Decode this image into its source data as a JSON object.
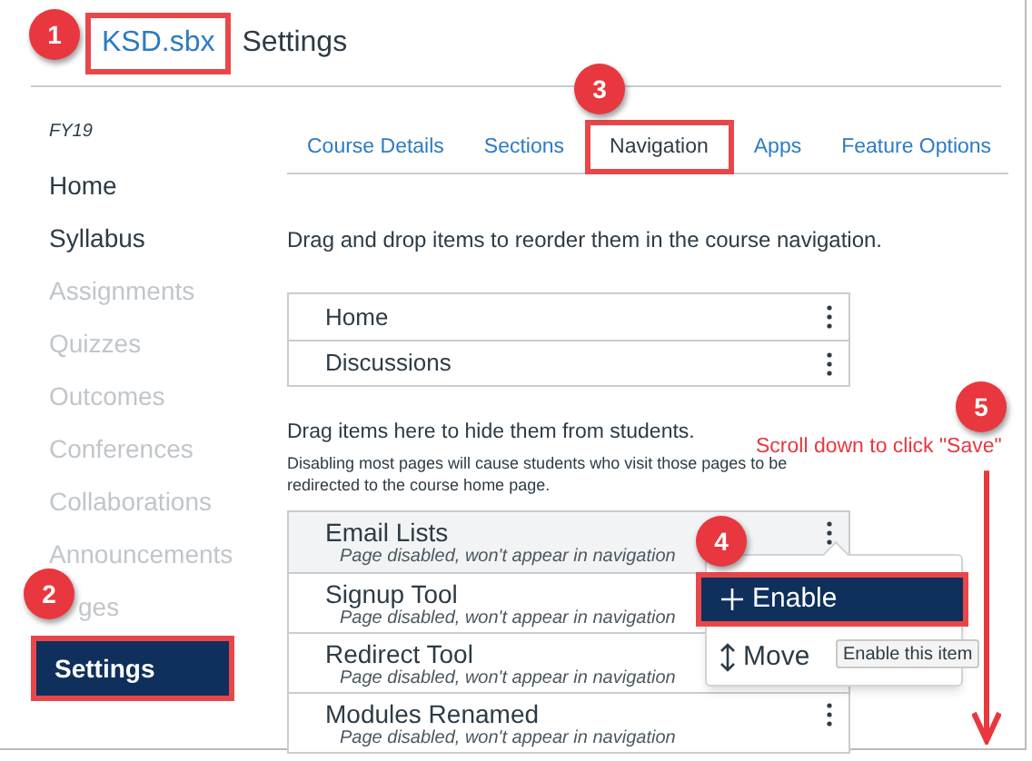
{
  "header": {
    "course_link": {
      "text": "KSD.sbx",
      "marked": true
    },
    "title": "Settings"
  },
  "sidebar": {
    "term": "FY19",
    "items": [
      {
        "label": "Home",
        "disabled": false,
        "selected": false,
        "marked": false
      },
      {
        "label": "Syllabus",
        "disabled": false,
        "selected": false,
        "marked": false
      },
      {
        "label": "Assignments",
        "disabled": true,
        "selected": false,
        "marked": false
      },
      {
        "label": "Quizzes",
        "disabled": true,
        "selected": false,
        "marked": false
      },
      {
        "label": "Outcomes",
        "disabled": true,
        "selected": false,
        "marked": false
      },
      {
        "label": "Conferences",
        "disabled": true,
        "selected": false,
        "marked": false
      },
      {
        "label": "Collaborations",
        "disabled": true,
        "selected": false,
        "marked": false
      },
      {
        "label": "Announcements",
        "disabled": true,
        "selected": false,
        "marked": false
      },
      {
        "label": "ges",
        "disabled": true,
        "selected": false,
        "marked": false
      },
      {
        "label": "Settings",
        "disabled": false,
        "selected": true,
        "marked": true
      }
    ]
  },
  "tabs": [
    {
      "label": "Course Details",
      "selected": false,
      "marked": false
    },
    {
      "label": "Sections",
      "selected": false,
      "marked": false
    },
    {
      "label": "Navigation",
      "selected": true,
      "marked": true
    },
    {
      "label": "Apps",
      "selected": false,
      "marked": false
    },
    {
      "label": "Feature Options",
      "selected": false,
      "marked": false
    }
  ],
  "navigation": {
    "instructions": "Drag and drop items to reorder them in the course navigation.",
    "enabled_items": [
      {
        "label": "Home"
      },
      {
        "label": "Discussions"
      }
    ],
    "hidden_heading": "Drag items here to hide them from students.",
    "hidden_note": "Disabling most pages will cause students who visit those pages to be redirected to the course home page.",
    "hidden_items": [
      {
        "label": "Email Lists",
        "status": "Page disabled, won't appear in navigation",
        "selected": true
      },
      {
        "label": "Signup Tool",
        "status": "Page disabled, won't appear in navigation",
        "selected": false
      },
      {
        "label": "Redirect Tool",
        "status": "Page disabled, won't appear in navigation",
        "selected": false
      },
      {
        "label": "Modules Renamed",
        "status": "Page disabled, won't appear in navigation",
        "selected": false
      }
    ]
  },
  "context_menu": {
    "items": [
      {
        "kind": "enable",
        "label": "Enable",
        "selected": true,
        "marked": true
      },
      {
        "kind": "move",
        "label": "Move",
        "selected": false,
        "marked": false
      }
    ],
    "tooltip": "Enable this item"
  },
  "annotations": {
    "badges": [
      {
        "number": "1"
      },
      {
        "number": "2"
      },
      {
        "number": "3"
      },
      {
        "number": "4"
      },
      {
        "number": "5"
      }
    ],
    "callout": "Scroll down to click \"Save\""
  }
}
